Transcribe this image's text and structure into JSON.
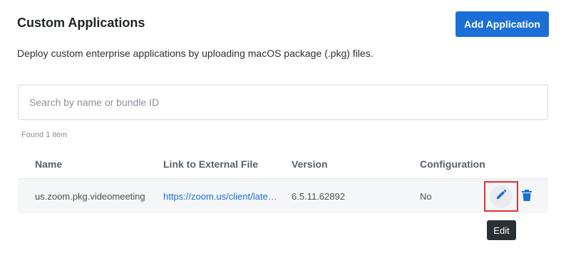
{
  "header": {
    "title": "Custom Applications",
    "add_button_label": "Add Application",
    "description": "Deploy custom enterprise applications by uploading macOS package (.pkg) files."
  },
  "search": {
    "placeholder": "Search by name or bundle ID",
    "value": ""
  },
  "results": {
    "found_text": "Found 1 item"
  },
  "table": {
    "columns": [
      "Name",
      "Link to External File",
      "Version",
      "Configuration"
    ],
    "rows": [
      {
        "name": "us.zoom.pkg.videomeeting",
        "link": "https://zoom.us/client/latest/zoomusInstallerFull.pkg",
        "version": "6.5.11.62892",
        "configuration": "No"
      }
    ]
  },
  "actions": {
    "edit_icon": "pencil-icon",
    "delete_icon": "trash-icon",
    "tooltip": "Edit"
  },
  "colors": {
    "accent": "#1b6fd6",
    "highlight": "#e03131",
    "row_bg": "#f5f6f7",
    "tooltip_bg": "#2b3034"
  }
}
